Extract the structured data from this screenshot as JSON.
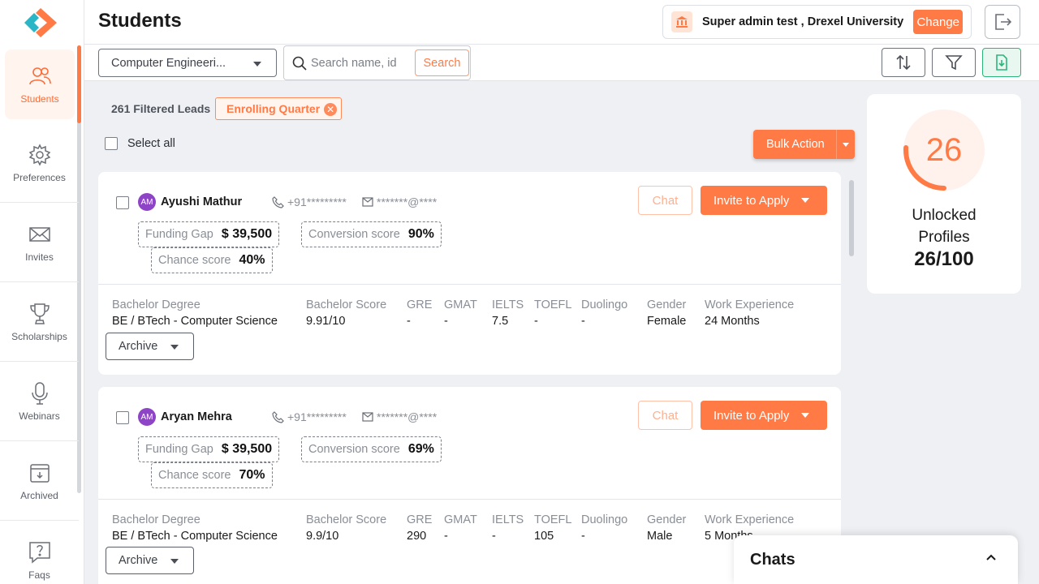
{
  "header": {
    "title": "Students",
    "university": "Super admin test , Drexel University",
    "change_label": "Change"
  },
  "sidebar": {
    "items": [
      {
        "label": "Students",
        "icon": "users-icon",
        "active": true
      },
      {
        "label": "Preferences",
        "icon": "gear-icon"
      },
      {
        "label": "Invites",
        "icon": "envelope-icon"
      },
      {
        "label": "Scholarships",
        "icon": "trophy-icon"
      },
      {
        "label": "Webinars",
        "icon": "microphone-icon"
      },
      {
        "label": "Archived",
        "icon": "archive-icon"
      },
      {
        "label": "Faqs",
        "icon": "question-icon"
      }
    ]
  },
  "toolbar": {
    "department": "Computer Engineeri...",
    "search_placeholder": "Search name, id",
    "search_label": "Search"
  },
  "filters": {
    "count_text": "261 Filtered Leads",
    "chip": "Enrolling Quarter",
    "select_all": "Select all",
    "bulk_action": "Bulk Action"
  },
  "field_labels": {
    "bachelor_degree": "Bachelor Degree",
    "bachelor_score": "Bachelor Score",
    "gre": "GRE",
    "gmat": "GMAT",
    "ielts": "IELTS",
    "toefl": "TOEFL",
    "duolingo": "Duolingo",
    "gender": "Gender",
    "work_experience": "Work Experience",
    "funding_gap": "Funding Gap",
    "conversion_score": "Conversion score",
    "chance_score": "Chance score"
  },
  "buttons": {
    "chat": "Chat",
    "invite": "Invite to Apply",
    "archive": "Archive"
  },
  "students": [
    {
      "initials": "AM",
      "name": "Ayushi Mathur",
      "phone": "+91*********",
      "email": "*******@****",
      "funding_gap": "$ 39,500",
      "conversion_score": "90%",
      "chance_score": "40%",
      "bachelor_degree": "BE / BTech - Computer Science",
      "bachelor_score": "9.91/10",
      "gre": "-",
      "gmat": "-",
      "ielts": "7.5",
      "toefl": "-",
      "duolingo": "-",
      "gender": "Female",
      "work_experience": "24 Months"
    },
    {
      "initials": "AM",
      "name": "Aryan Mehra",
      "phone": "+91*********",
      "email": "*******@****",
      "funding_gap": "$ 39,500",
      "conversion_score": "69%",
      "chance_score": "70%",
      "bachelor_degree": "BE / BTech - Computer Science",
      "bachelor_score": "9.9/10",
      "gre": "290",
      "gmat": "-",
      "ielts": "-",
      "toefl": "105",
      "duolingo": "-",
      "gender": "Male",
      "work_experience": "5 Months"
    }
  ],
  "unlocked": {
    "number": "26",
    "label_line1": "Unlocked",
    "label_line2": "Profiles",
    "count": "26/100",
    "fraction": 0.26
  },
  "chats": {
    "title": "Chats"
  },
  "colors": {
    "accent": "#ff7a45",
    "avatar": "#8e44c6",
    "export": "#2cb57a"
  }
}
